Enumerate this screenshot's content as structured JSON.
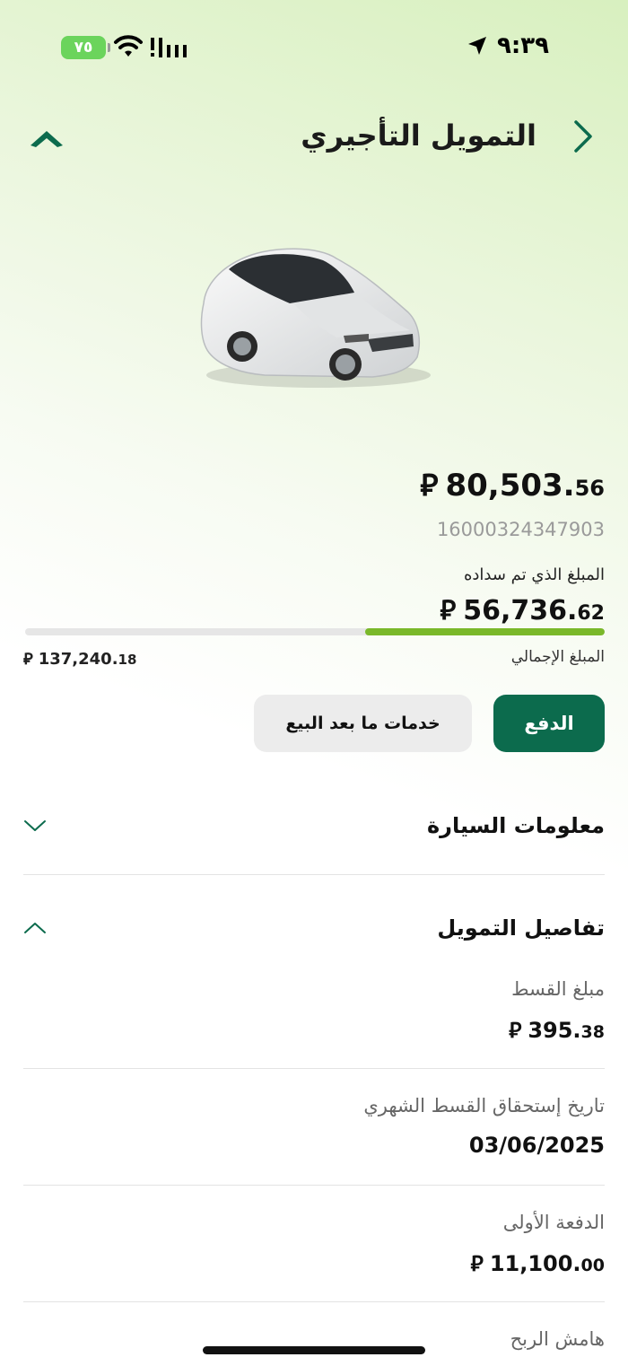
{
  "status_bar": {
    "time": "٩:٣٩",
    "battery": "٧٥"
  },
  "header": {
    "title": "التمويل التأجيري"
  },
  "finance": {
    "currency_symbol": "⃁",
    "remaining_amount_int": "80,503.",
    "remaining_amount_dec": "56",
    "contract_number": "16000324347903",
    "paid_label": "المبلغ الذي تم سداده",
    "paid_amount_int": "56,736.",
    "paid_amount_dec": "62",
    "total_label": "المبلغ الإجمالي",
    "total_amount_int": "137,240.",
    "total_amount_dec": "18",
    "progress_fraction": 0.413,
    "progress_color": "#7ab82a"
  },
  "actions": {
    "pay_label": "الدفع",
    "after_sales_label": "خدمات ما بعد البيع"
  },
  "sections": {
    "car_info_title": "معلومات السيارة",
    "finance_details_title": "تفاصيل التمويل"
  },
  "details": {
    "installment_label": "مبلغ القسط",
    "installment_int": "395.",
    "installment_dec": "38",
    "due_date_label": "تاريخ إستحقاق القسط الشهري",
    "due_date_value": "03/06/2025",
    "down_payment_label": "الدفعة الأولى",
    "down_payment_int": "11,100.",
    "down_payment_dec": "00",
    "profit_margin_label": "هامش الربح"
  },
  "colors": {
    "brand_green": "#0c6b4d",
    "accent_green": "#7ab82a"
  },
  "icons": {
    "back": "chevron-right-icon",
    "home": "home-icon",
    "expand": "chevron-down-icon",
    "collapse": "chevron-up-icon"
  }
}
